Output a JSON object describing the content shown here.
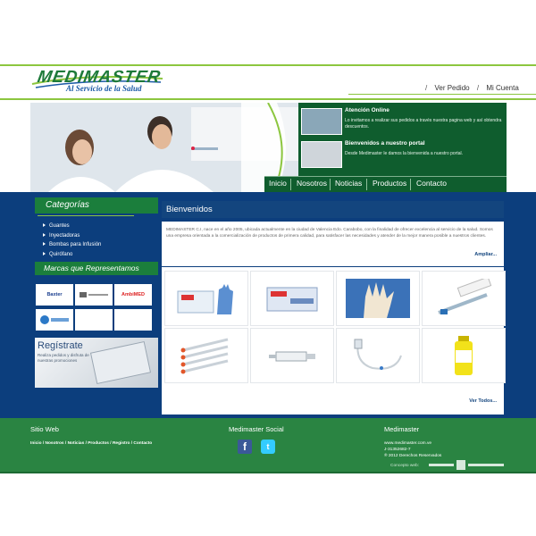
{
  "brand": {
    "logo_text": "MEDIMASTER",
    "slogan": "Al Servicio de la Salud"
  },
  "top_links": [
    {
      "label": "Ver Pedido"
    },
    {
      "label": "Mi Cuenta"
    }
  ],
  "news": [
    {
      "title": "Atención Online",
      "body": "Lo invitamos a realizar sus pedidos a través nuestra pagina web y así obtendra descuentos."
    },
    {
      "title": "Bienvenidos a nuestro portal",
      "body": "Desde Medimaster le damos la bienvenida a nuestro portal."
    }
  ],
  "nav": [
    {
      "label": "Inicio"
    },
    {
      "label": "Nosotros"
    },
    {
      "label": "Noticias"
    },
    {
      "label": "Productos"
    },
    {
      "label": "Contacto"
    }
  ],
  "sidebar": {
    "categories_title": "Categorías",
    "categories": [
      "Guantes",
      "Inyectadoras",
      "Bombas para Infusión",
      "Quirófano"
    ],
    "brands_title": "Marcas que Representamos",
    "brands": [
      "Baxter",
      "",
      "AmbiMED",
      "",
      "",
      ""
    ],
    "register_title": "Regístrate",
    "register_text": "Realiza pedidos y disfruta de nuestras promociones"
  },
  "content": {
    "title": "Bienvenidos",
    "intro": "MEDIMASTER C.I, nace en el año 2005, ubicada actualmente en la ciudad de Valencia Edo. Carabobo, con la finalidad de ofrecer excelencia al servicio de la salud. Somos una empresa orientada a la comercialización de productos de primera calidad, para satisfacer las necesidades y atender de la mejor manera posible a nuestros clientes.",
    "more_link": "Ampliar...",
    "view_all": "Ver Todos..."
  },
  "footer": {
    "col1_title": "Sitio Web",
    "col1_links": "Inicio / Nosotros / Noticias / Productos / Registro / Contacto",
    "col2_title": "Medimaster Social",
    "col3_title": "Medimaster",
    "col3_lines": [
      "www.medimaster.com.ve",
      "J-31352682-7",
      "® 2012 Derechos Reservados"
    ],
    "credit": "Concepto web:"
  },
  "colors": {
    "green": "#1b7e3c",
    "navy": "#0c3e7d",
    "accent": "#8cc63f"
  }
}
